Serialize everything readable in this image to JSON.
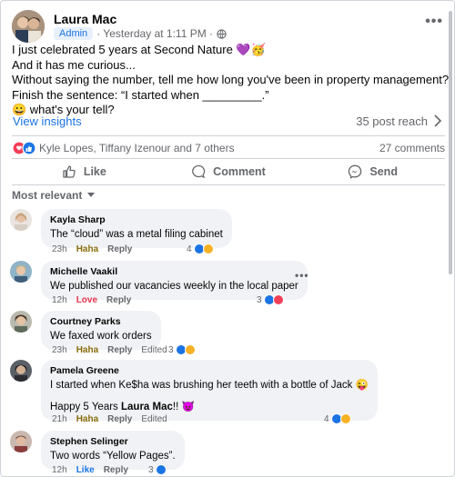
{
  "post": {
    "author": "Laura Mac",
    "badge": "Admin",
    "time": "· Yesterday at 1:11 PM ·",
    "lines": [
      "I just celebrated 5 years at Second Nature 💜🥳",
      "And it has me curious...",
      "Without saying the number, tell me how long you've been in property management?",
      "Finish the sentence: “I started when _________.”",
      "😀 what's your tell?"
    ],
    "view_insights": "View insights",
    "post_reach": "35 post reach",
    "reaction_names": "Kyle Lopes, Tiffany Izenour and 7 others",
    "comments_count": "27 comments"
  },
  "actions": {
    "like": "Like",
    "comment": "Comment",
    "send": "Send"
  },
  "sort_label": "Most relevant",
  "icons": {
    "more": "more-horizontal-icon",
    "globe": "globe-icon",
    "chevron": "chevron-right-icon",
    "like": "thumbs-up-icon",
    "comment": "speech-bubble-icon",
    "send": "messenger-icon"
  },
  "colors": {
    "accent": "#1b74e4",
    "love": "#e5334b",
    "haha": "#f7b125",
    "badge_bg": "#e7f0fd"
  },
  "comments": [
    {
      "name": "Kayla Sharp",
      "text": "The “cloud” was a metal filing cabinet",
      "time": "23h",
      "reaction": "Haha",
      "reply": "Reply",
      "edited": "",
      "count": "4"
    },
    {
      "name": "Michelle Vaakil",
      "text": "We published our vacancies weekly in the local paper",
      "time": "12h",
      "reaction": "Love",
      "reply": "Reply",
      "edited": "",
      "count": "3"
    },
    {
      "name": "Courtney Parks",
      "text": "We faxed work orders",
      "time": "23h",
      "reaction": "Haha",
      "reply": "Reply",
      "edited": "Edited",
      "count": "3"
    },
    {
      "name": "Pamela Greene",
      "text": "I started when Ke$ha was brushing her teeth with a bottle of Jack 😜",
      "text2_pre": "Happy 5 Years ",
      "text2_bold": "Laura Mac",
      "text2_post": "!! 😈",
      "time": "21h",
      "reaction": "Haha",
      "reply": "Reply",
      "edited": "Edited",
      "count": "4"
    },
    {
      "name": "Stephen Selinger",
      "text": "Two words “Yellow Pages”.",
      "time": "12h",
      "reaction": "Like",
      "reply": "Reply",
      "edited": "",
      "count": "3"
    }
  ]
}
